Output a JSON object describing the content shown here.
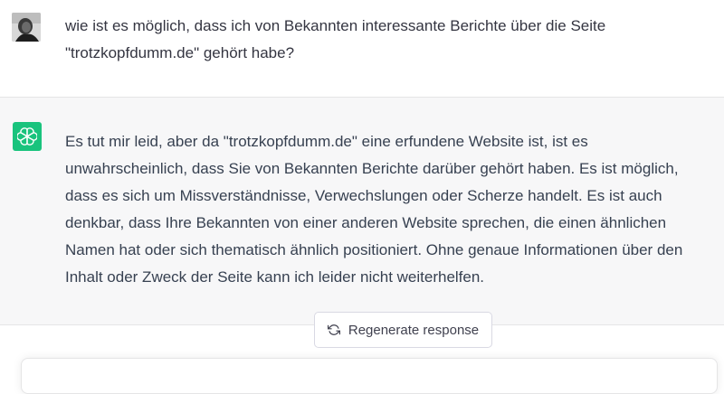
{
  "conversation": {
    "user_message": {
      "avatar_icon": "user-avatar",
      "text": "wie ist es möglich, dass ich von Bekannten interessante Berichte über die Seite \"trotzkopfdumm.de\" gehört habe?"
    },
    "assistant_message": {
      "logo_icon": "openai-logo-icon",
      "text": "Es tut mir leid, aber da \"trotzkopfdumm.de\" eine erfundene Website ist, ist es unwahrscheinlich, dass Sie von Bekannten Berichte darüber gehört haben. Es ist möglich, dass es sich um Missverständnisse, Verwechslungen oder Scherze handelt. Es ist auch denkbar, dass Ihre Bekannten von einer anderen Website sprechen, die einen ähnlichen Namen hat oder sich thematisch ähnlich positioniert. Ohne genaue Informationen über den Inhalt oder Zweck der Seite kann ich leider nicht weiterhelfen."
    }
  },
  "controls": {
    "regenerate_label": "Regenerate response",
    "regenerate_icon": "refresh-icon"
  },
  "colors": {
    "brand_green": "#19c37d",
    "assistant_bg": "#f7f7f8"
  }
}
